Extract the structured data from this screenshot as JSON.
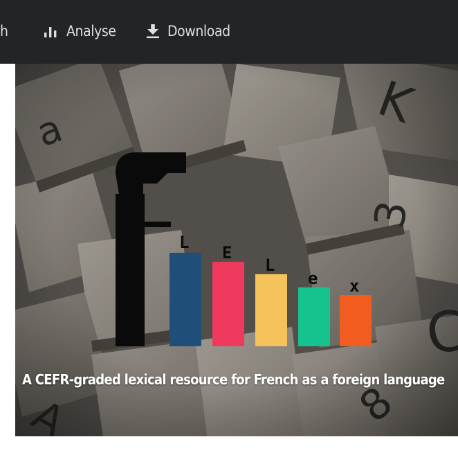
{
  "navbar": {
    "partial_label": "h",
    "items": [
      {
        "label": "Analyse",
        "icon": "bar-chart-icon"
      },
      {
        "label": "Download",
        "icon": "download-icon"
      }
    ]
  },
  "hero": {
    "background": "scrabble-tiles-photo",
    "logo": {
      "letters": [
        "f",
        "L",
        "E",
        "L",
        "e",
        "x"
      ],
      "bar_colors": [
        "#1f4e79",
        "#ef3a5d",
        "#f6c35b",
        "#14c38e",
        "#f25c1f"
      ],
      "stem_color": "#0a0a0a"
    },
    "tagline": "A CEFR-graded lexical resource for French as a foreign language"
  }
}
